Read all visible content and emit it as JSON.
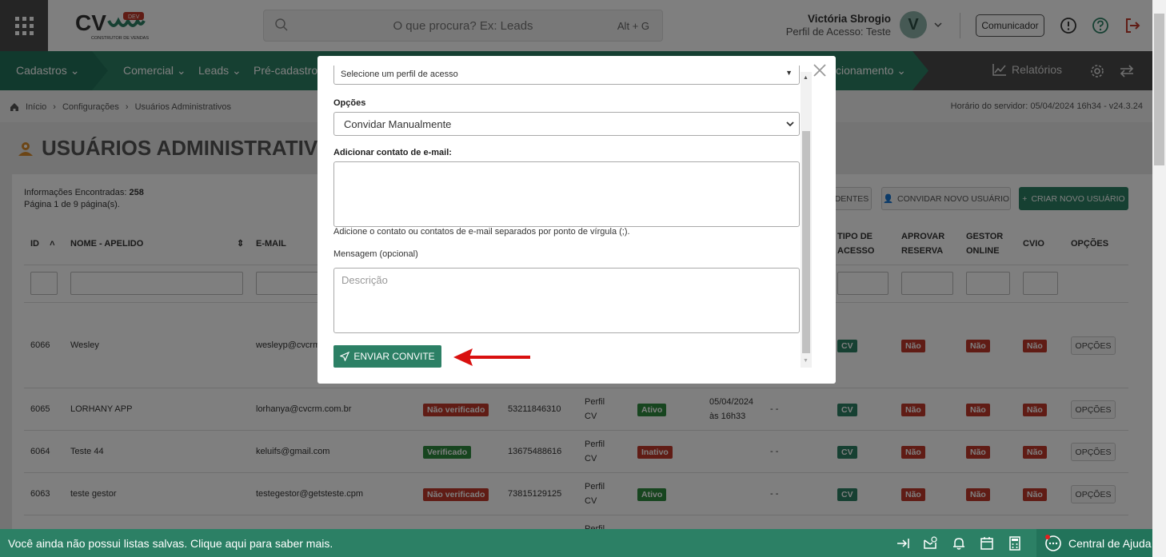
{
  "header": {
    "logo_text": "CV",
    "logo_tag": "DEV",
    "logo_sub": "CONSTRUTOR DE VENDAS",
    "search_placeholder": "O que procura? Ex: Leads",
    "search_shortcut": "Alt + G",
    "user_name": "Victória Sbrogio",
    "user_profile": "Perfil de Acesso: Teste",
    "avatar_letter": "V",
    "comunicador_label": "Comunicador"
  },
  "nav": {
    "items": [
      "Cadastros",
      "Comercial",
      "Leads",
      "Pré-cadastros",
      "cionamento"
    ],
    "reports_label": "Relatórios"
  },
  "breadcrumb": {
    "items": [
      "Início",
      "Configurações",
      "Usuários Administrativos"
    ],
    "server_time": "Horário do servidor: 05/04/2024 16h34 - v24.3.24"
  },
  "page": {
    "title": "USUÁRIOS ADMINISTRATIVO",
    "info_found_label": "Informações Encontradas:",
    "info_found_value": "258",
    "pagination_text": "Página 1 de 9 página(s).",
    "btn_pendentes": "DENTES",
    "btn_convidar": "CONVIDAR NOVO USUÁRIO",
    "btn_criar": "CRIAR NOVO USUÁRIO"
  },
  "table": {
    "headers": {
      "id": "ID",
      "nome": "NOME - APELIDO",
      "email": "E-MAIL",
      "tipo_acesso": "TIPO DE ACESSO",
      "aprovar_reserva": "APROVAR RESERVA",
      "gestor_online": "GESTOR ONLINE",
      "cvio": "CVIO",
      "opcoes": "OPÇÕES"
    },
    "rows": [
      {
        "id": "6066",
        "nome": "Wesley",
        "email": "wesleyp@cvcrm",
        "verif": "",
        "fone": "",
        "perfil": "",
        "situacao": "",
        "data": "",
        "extra": "",
        "tipo": "CV",
        "aprovar": "Não",
        "gestor": "Não",
        "cvio": "Não",
        "opcoes": "OPÇÕES"
      },
      {
        "id": "6065",
        "nome": "LORHANY APP",
        "email": "lorhanya@cvcrm.com.br",
        "verif": "Não verificado",
        "fone": "53211846310",
        "perfil": "Perfil CV",
        "situacao": "Ativo",
        "data": "05/04/2024 às 16h33",
        "extra": "- -",
        "tipo": "CV",
        "aprovar": "Não",
        "gestor": "Não",
        "cvio": "Não",
        "opcoes": "OPÇÕES"
      },
      {
        "id": "6064",
        "nome": "Teste 44",
        "email": "keluifs@gmail.com",
        "verif": "Verificado",
        "fone": "13675488616",
        "perfil": "Perfil CV",
        "situacao": "Inativo",
        "data": "",
        "extra": "- -",
        "tipo": "CV",
        "aprovar": "Não",
        "gestor": "Não",
        "cvio": "Não",
        "opcoes": "OPÇÕES"
      },
      {
        "id": "6063",
        "nome": "teste gestor",
        "email": "testegestor@getsteste.cpm",
        "verif": "Não verificado",
        "fone": "73815129125",
        "perfil": "Perfil CV",
        "situacao": "Ativo",
        "data": "",
        "extra": "- -",
        "tipo": "CV",
        "aprovar": "Não",
        "gestor": "Não",
        "cvio": "Não",
        "opcoes": "OPÇÕES"
      }
    ],
    "partial_perfil": "Perfil"
  },
  "modal": {
    "perfil_select_value": "Selecione um perfil de acesso",
    "opcoes_label": "Opções",
    "opcoes_value": "Convidar Manualmente",
    "email_label": "Adicionar contato de e-mail:",
    "email_help": "Adicione o contato ou contatos de e-mail separados por ponto de vírgula (;).",
    "mensagem_label": "Mensagem (opcional)",
    "mensagem_placeholder": "Descrição",
    "send_label": "ENVIAR CONVITE"
  },
  "footer": {
    "message": "Você ainda não possui listas salvas. Clique aqui para saber mais.",
    "help_label": "Central de Ajuda"
  },
  "colors": {
    "primary": "#2c8065",
    "danger": "#c0392b",
    "success": "#2e8b3e"
  }
}
